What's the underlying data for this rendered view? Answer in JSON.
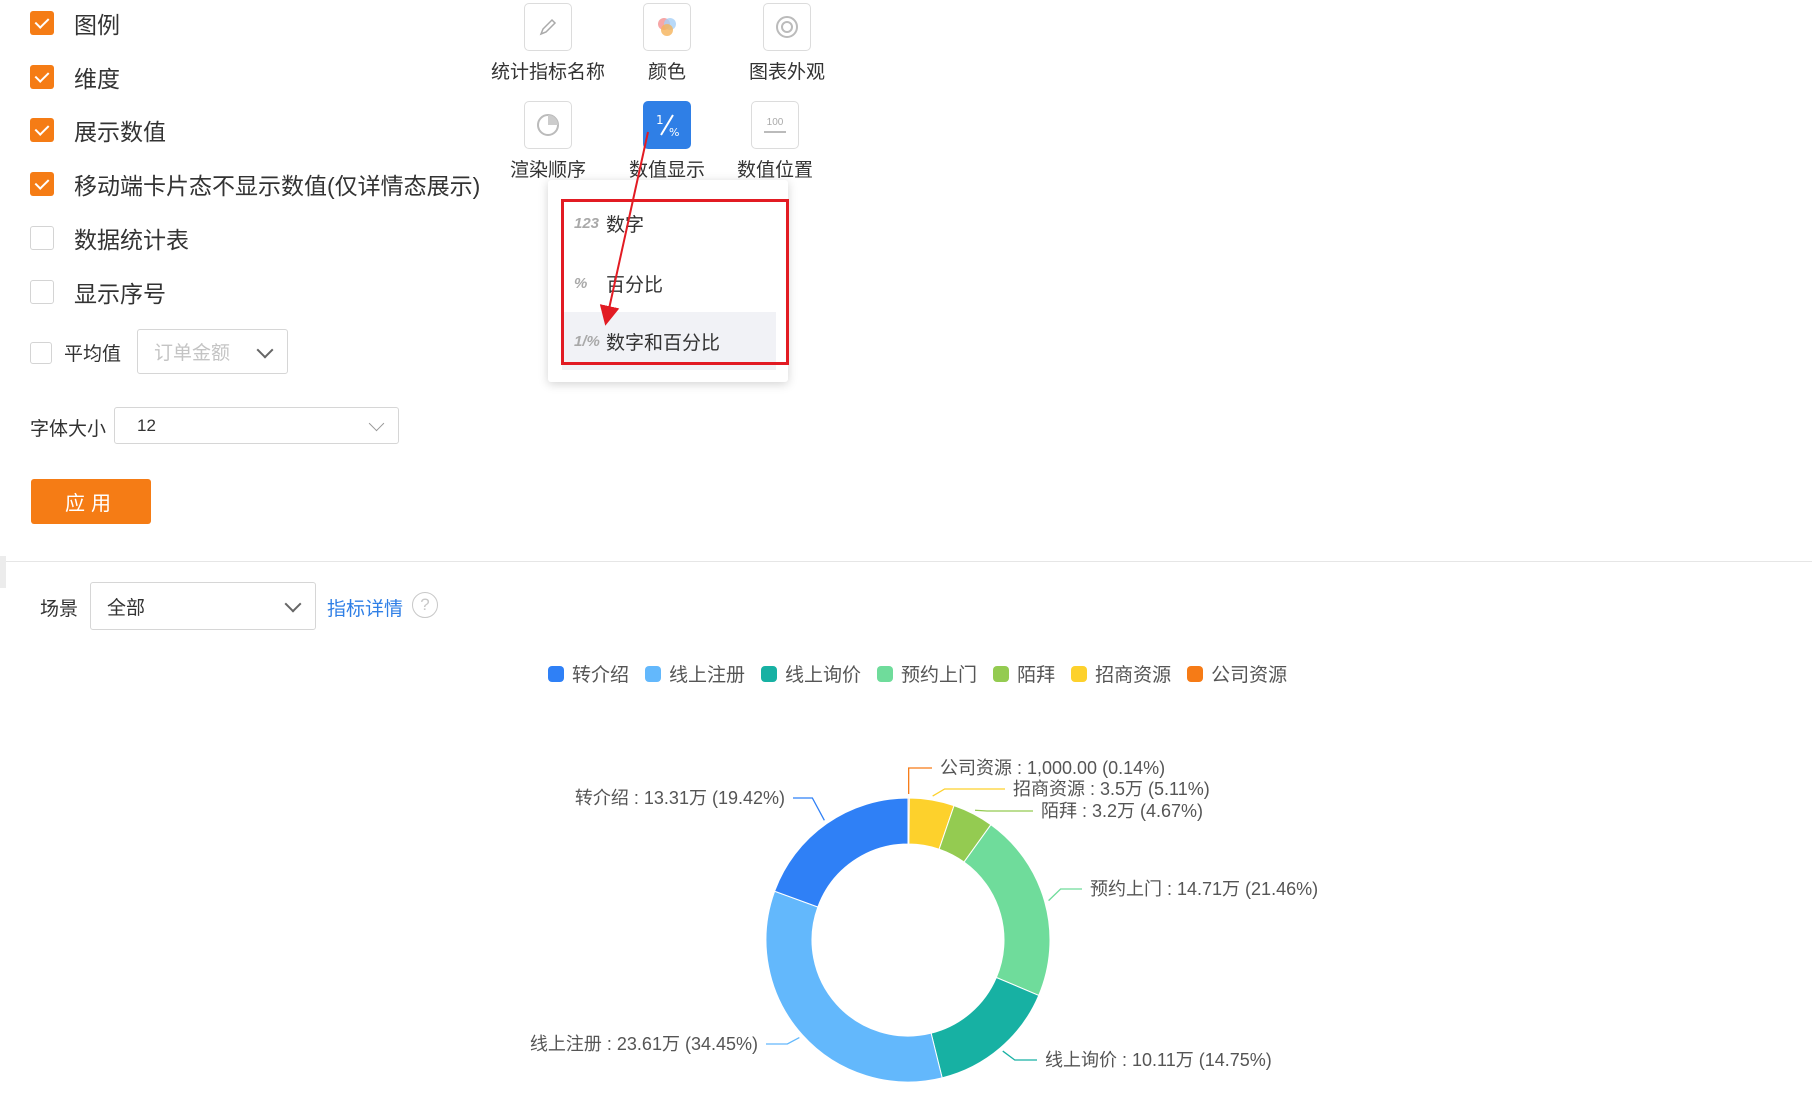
{
  "options": {
    "legend": {
      "label": "图例",
      "checked": true
    },
    "dimension": {
      "label": "维度",
      "checked": true
    },
    "show_values": {
      "label": "展示数值",
      "checked": true
    },
    "mobile_hide": {
      "label": "移动端卡片态不显示数值(仅详情态展示)",
      "checked": true
    },
    "stats_table": {
      "label": "数据统计表",
      "checked": false
    },
    "show_index": {
      "label": "显示序号",
      "checked": false
    },
    "average": {
      "label": "平均值",
      "checked": false,
      "select_placeholder": "订单金额"
    },
    "font_size": {
      "label": "字体大小",
      "value": "12"
    },
    "apply_label": "应用"
  },
  "tools": {
    "metric_name": "统计指标名称",
    "color": "颜色",
    "appearance": "图表外观",
    "render_order": "渲染顺序",
    "value_display": "数值显示",
    "value_position": "数值位置",
    "value_position_icon_text": "100"
  },
  "value_display_menu": {
    "items": [
      {
        "icon_text": "123",
        "label": "数字"
      },
      {
        "icon_text": "%",
        "label": "百分比"
      },
      {
        "icon_text": "1/%",
        "label": "数字和百分比",
        "highlighted": true
      }
    ]
  },
  "scene": {
    "label": "场景",
    "value": "全部",
    "detail_link": "指标详情",
    "help_icon": "?"
  },
  "colors": {
    "accent": "#f57c15",
    "link": "#2f7fe6",
    "annotation_red": "#e21b23"
  },
  "chart_data": {
    "type": "pie",
    "donut": true,
    "legend_position": "top-center",
    "categories": [
      "转介绍",
      "线上注册",
      "线上询价",
      "预约上门",
      "陌拜",
      "招商资源",
      "公司资源"
    ],
    "values": [
      133100,
      236100,
      101100,
      147100,
      32000,
      35000,
      1000
    ],
    "percents": [
      19.42,
      34.45,
      14.75,
      21.46,
      4.67,
      5.11,
      0.14
    ],
    "colors": [
      "#2f80f6",
      "#63b8fc",
      "#17b1a3",
      "#6fdc9b",
      "#94cb51",
      "#fdd12c",
      "#f67b16"
    ],
    "labels": [
      "转介绍 : 13.31万 (19.42%)",
      "线上注册 : 23.61万 (34.45%)",
      "线上询价 : 10.11万 (14.75%)",
      "预约上门 : 14.71万 (21.46%)",
      "陌拜 : 3.2万 (4.67%)",
      "招商资源 : 3.5万 (5.11%)",
      "公司资源 : 1,000.00 (0.14%)"
    ]
  }
}
